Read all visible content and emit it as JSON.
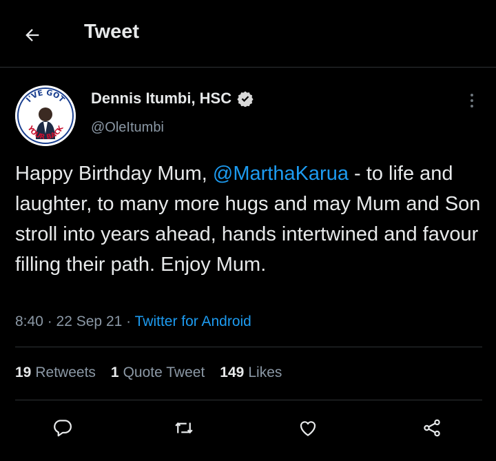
{
  "header": {
    "title": "Tweet",
    "back_icon": "arrow-left-icon"
  },
  "author": {
    "name": "Dennis Itumbi, HSC",
    "handle": "@OleItumbi",
    "verified": true,
    "avatar_text_top": "I'VE GOT",
    "avatar_text_bottom": "YOUR BACK"
  },
  "tweet": {
    "text_before": "Happy Birthday Mum, ",
    "mention": "@MarthaKarua",
    "text_after": " - to life and laughter, to many more hugs and may Mum and Son stroll into years ahead, hands intertwined and favour filling their path. Enjoy Mum."
  },
  "meta": {
    "time": "8:40",
    "sep1": " · ",
    "date": "22 Sep 21",
    "sep2": " · ",
    "source": "Twitter for Android"
  },
  "stats": {
    "retweets_count": "19",
    "retweets_label": "Retweets",
    "quotes_count": "1",
    "quotes_label": "Quote Tweet",
    "likes_count": "149",
    "likes_label": "Likes"
  },
  "actions": [
    "reply-icon",
    "retweet-icon",
    "like-icon",
    "share-icon"
  ],
  "colors": {
    "accent": "#1d9bf0",
    "background": "#000000",
    "muted": "#8b98a5"
  }
}
